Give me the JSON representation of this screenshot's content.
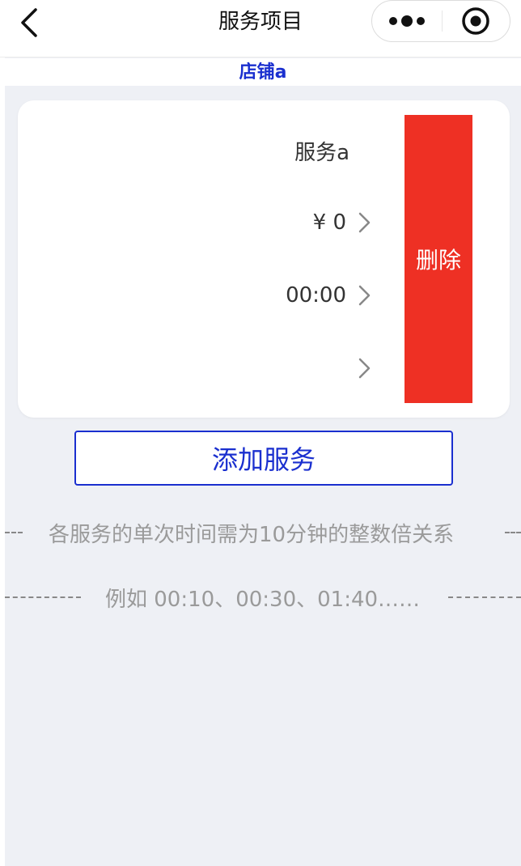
{
  "navbar": {
    "title": "服务项目",
    "back_icon": "chevron-left-icon",
    "more_icon": "more-dots-icon",
    "target_icon": "target-circle-icon"
  },
  "shop": {
    "name": "店铺a"
  },
  "service": {
    "name": "服务a",
    "price": "¥ 0",
    "time": "00:00",
    "extra": "",
    "delete_label": "删除"
  },
  "add_button": {
    "label": "添加服务"
  },
  "tips": {
    "line1": "各服务的单次时间需为10分钟的整数倍关系",
    "line2": "例如 00:10、00:30、01:40……"
  },
  "colors": {
    "accent": "#1a2fcf",
    "danger": "#ee3024",
    "background": "#eef0f5",
    "tip_text": "#9a9a9a"
  }
}
